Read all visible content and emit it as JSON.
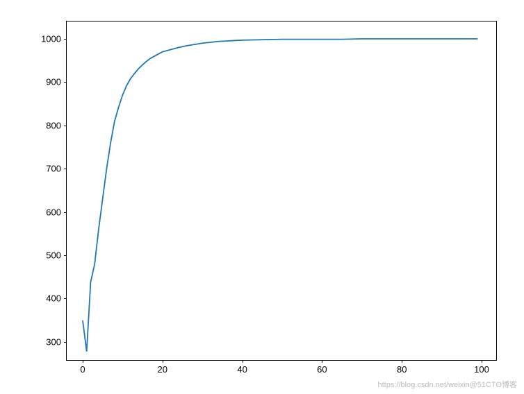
{
  "chart_data": {
    "type": "line",
    "x": [
      0,
      1,
      2,
      3,
      4,
      5,
      6,
      7,
      8,
      9,
      10,
      11,
      12,
      13,
      14,
      15,
      16,
      17,
      18,
      19,
      20,
      22,
      24,
      26,
      28,
      30,
      32,
      34,
      36,
      38,
      40,
      45,
      50,
      55,
      60,
      65,
      70,
      75,
      80,
      85,
      90,
      95,
      99
    ],
    "y": [
      350,
      278,
      438,
      480,
      560,
      630,
      700,
      760,
      810,
      842,
      870,
      892,
      908,
      920,
      931,
      940,
      948,
      955,
      960,
      965,
      970,
      975,
      980,
      984,
      987,
      990,
      992,
      994,
      995,
      996,
      997,
      998,
      999,
      999,
      999,
      999,
      1000,
      1000,
      1000,
      1000,
      1000,
      1000,
      1000
    ],
    "title": "",
    "xlabel": "",
    "ylabel": "",
    "xlim": [
      -4,
      104
    ],
    "ylim": [
      255,
      1040
    ],
    "xticks": [
      0,
      20,
      40,
      60,
      80,
      100
    ],
    "yticks": [
      300,
      400,
      500,
      600,
      700,
      800,
      900,
      1000
    ],
    "line_color": "#1f77b4"
  },
  "watermark": "https://blog.csdn.net/weixin@51CTO博客"
}
